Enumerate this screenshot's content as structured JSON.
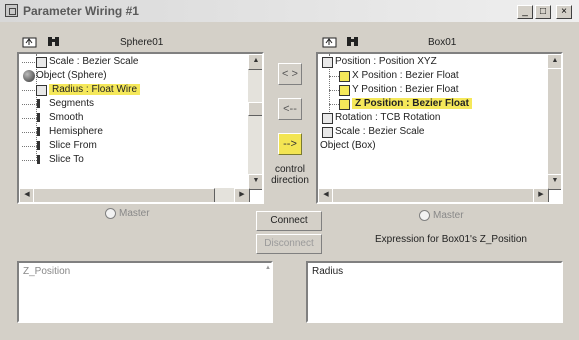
{
  "window": {
    "title": "Parameter Wiring #1",
    "buttons": {
      "minimize": "_",
      "maximize": "□",
      "close": "×"
    }
  },
  "left_panel": {
    "object_name": "Sphere01",
    "tree": [
      {
        "text": "Scale : Bezier Scale",
        "highlighted": false
      },
      {
        "text": "Object (Sphere)",
        "highlighted": false
      },
      {
        "text": "Radius : Float Wire",
        "highlighted": true
      },
      {
        "text": "Segments",
        "highlighted": false
      },
      {
        "text": "Smooth",
        "highlighted": false
      },
      {
        "text": "Hemisphere",
        "highlighted": false
      },
      {
        "text": "Slice From",
        "highlighted": false
      },
      {
        "text": "Slice To",
        "highlighted": false
      }
    ],
    "master_label": "Master",
    "expression": "Z_Position"
  },
  "right_panel": {
    "object_name": "Box01",
    "tree": [
      {
        "text": "Position : Position XYZ",
        "highlighted": false
      },
      {
        "text": "X Position : Bezier Float",
        "highlighted": false
      },
      {
        "text": "Y Position : Bezier Float",
        "highlighted": false
      },
      {
        "text": "Z Position : Bezier Float",
        "highlighted": true
      },
      {
        "text": "Rotation : TCB Rotation",
        "highlighted": false
      },
      {
        "text": "Scale : Bezier Scale",
        "highlighted": false
      },
      {
        "text": "Object (Box)",
        "highlighted": false
      }
    ],
    "master_label": "Master",
    "expression_label": "Expression for Box01's Z_Position",
    "expression": "Radius"
  },
  "center": {
    "arrow_both": "< >",
    "arrow_left": "<--",
    "arrow_right": "-->",
    "control_direction": "control\ndirection",
    "connect_label": "Connect",
    "disconnect_label": "Disconnect"
  },
  "colors": {
    "highlight": "#f5e85a",
    "background": "#d4d0c8"
  },
  "icons": [
    "app-icon",
    "parent-folder-icon",
    "binoculars-icon",
    "sphere-icon",
    "float-icon"
  ]
}
